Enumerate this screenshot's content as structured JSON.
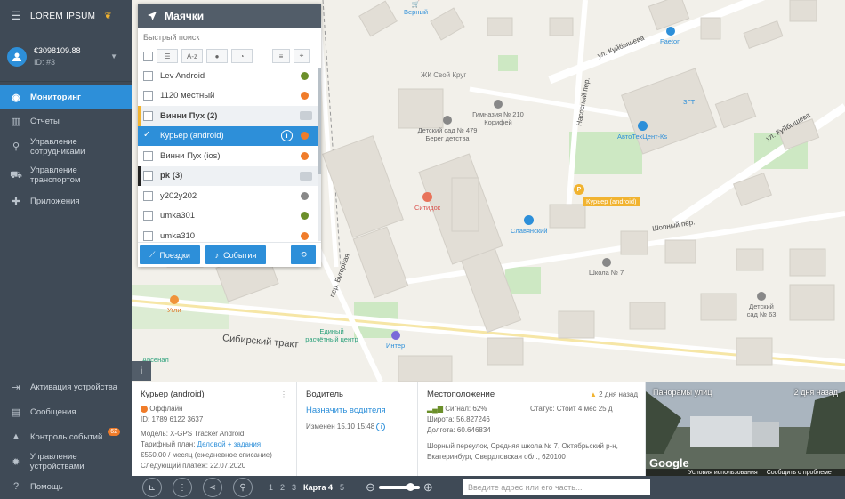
{
  "brand": {
    "name": "LOREM IPSUM"
  },
  "user": {
    "balance": "€3098109.88",
    "id": "ID: #3"
  },
  "nav": [
    {
      "label": "Мониторинг",
      "icon": "globe-icon",
      "active": true
    },
    {
      "label": "Отчеты",
      "icon": "chart-icon"
    },
    {
      "label": "Управление сотрудниками",
      "icon": "pin-icon"
    },
    {
      "label": "Управление транспортом",
      "icon": "car-icon"
    },
    {
      "label": "Приложения",
      "icon": "puzzle-icon"
    }
  ],
  "nav_bottom": [
    {
      "label": "Активация устройства",
      "icon": "login-icon"
    },
    {
      "label": "Сообщения",
      "icon": "chat-icon"
    },
    {
      "label": "Контроль событий",
      "icon": "bell-icon",
      "badge": "62"
    },
    {
      "label": "Управление устройствами",
      "icon": "gear-icon"
    },
    {
      "label": "Помощь",
      "icon": "help-icon"
    }
  ],
  "panel": {
    "title": "Маячки",
    "quick_search": "Быстрый поиск",
    "sort_az": "A-z",
    "rows": [
      {
        "label": "Lev Android",
        "color": "#6b8f2a"
      },
      {
        "label": "1120 местный",
        "color": "#f07c2a"
      },
      {
        "label": "Винни Пух (2)",
        "group": true,
        "bar": "#f1b330"
      },
      {
        "label": "Курьер (android)",
        "color": "#f07c2a",
        "selected": true
      },
      {
        "label": "Винни Пух (ios)",
        "color": "#f07c2a"
      },
      {
        "label": "pk (3)",
        "group": true,
        "bar": "#222222"
      },
      {
        "label": "y202y202",
        "color": "#888888"
      },
      {
        "label": "umka301",
        "color": "#6b8f2a"
      },
      {
        "label": "umka310",
        "color": "#f07c2a"
      }
    ],
    "btn_trips": "Поездки",
    "btn_events": "События"
  },
  "map_labels": {
    "kuibysheva1": "ул. Куйбышева",
    "kuibysheva2": "ул. Куйбышева",
    "shornyi": "Шорный пер.",
    "sibirsky": "Сибирский тракт",
    "bugrovaya": "пер. Бугорная",
    "nasosnyi": "Насосный пер.",
    "zhk": "ЖК Свой Круг",
    "verny": "Верный",
    "faeton": "Faeton",
    "zgt": "ЗГТ",
    "autotech": "АвтоТехЦент-Кs",
    "kindergarten1": "Детский сад № 479 Берег детства",
    "gym": "Гимназия № 210 Корифей",
    "citydoc": "Ситидок",
    "slavyansky": "Славянский",
    "school7": "Школа № 7",
    "kindergarten63": "Детский сад № 63",
    "ugli": "Угли",
    "edinyi": "Единый расчётный центр",
    "inter": "Интер",
    "arsenal": "Арсенал",
    "courier_tag": "Курьер (android)"
  },
  "info": {
    "device_name": "Курьер (android)",
    "status": "Оффлайн",
    "id": "ID: 1789 6122 3637",
    "model": "Модель: X-GPS Tracker Android",
    "tariff_label": "Тарифный план:",
    "tariff_link": "Деловой + задания",
    "tariff_price": "€550.00 / месяц (ежедневное списание)",
    "next_payment": "Следующий платеж: 22.07.2020",
    "driver_title": "Водитель",
    "assign_driver": "Назначить водителя",
    "changed": "Изменен 15.10 15:48",
    "location_title": "Местоположение",
    "ago": "2 дня назад",
    "signal": "Сигнал: 62%",
    "status_line": "Статус: Стоит 4 мес 25 д",
    "lat": "Широта: 56.827246",
    "lon": "Долгота: 60.646834",
    "address": "Шорный переулок, Средняя школа № 7, Октябрьский р-н, Екатеринбург, Свердловская обл., 620100",
    "panorama": "Панорамы улиц",
    "panorama_ago": "2 дня назад",
    "google": "Google",
    "terms": "Условия использования",
    "report": "Сообщить о проблеме"
  },
  "toolbar": {
    "pages": [
      "1",
      "2",
      "3",
      "Карта 4",
      "5"
    ],
    "address_placeholder": "Введите адрес или его часть..."
  },
  "colors": {
    "accent": "#2d8fd9",
    "sidebar": "#3f4a56",
    "orange": "#f07c2a"
  }
}
